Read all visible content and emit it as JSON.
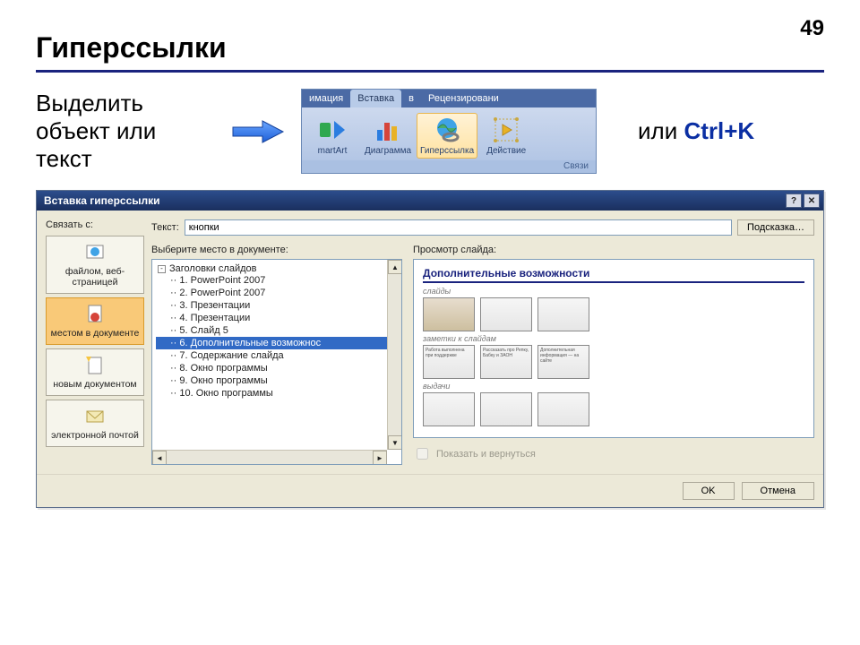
{
  "page_number": "49",
  "title": "Гиперссылки",
  "instruction": "Выделить объект или текст",
  "or_text": "или ",
  "shortcut": "Ctrl+K",
  "ribbon": {
    "tabs": [
      "имация",
      "Вставка",
      "в",
      "Рецензировани"
    ],
    "active_index": 1,
    "buttons": {
      "smartart": "martArt",
      "chart": "Диаграмма",
      "hyperlink": "Гиперссылка",
      "action": "Действие"
    },
    "group_label": "Связи"
  },
  "dialog": {
    "title": "Вставка гиперссылки",
    "link_with_label": "Связать с:",
    "text_label": "Текст:",
    "text_value": "кнопки",
    "hint_button": "Подсказка…",
    "link_targets": {
      "webpage": "файлом, веб-страницей",
      "place": "местом в документе",
      "newdoc": "новым документом",
      "email": "электронной почтой"
    },
    "tree_label": "Выберите место в документе:",
    "tree_root": "Заголовки слайдов",
    "tree_items": [
      "1. PowerPoint 2007",
      "2. PowerPoint 2007",
      "3. Презентации",
      "4. Презентации",
      "5. Слайд 5",
      "6. Дополнительные возможнос",
      "7. Содержание слайда",
      "8. Окно программы",
      "9. Окно программы",
      "10. Окно программы"
    ],
    "tree_selected_index": 5,
    "preview_label": "Просмотр слайда:",
    "preview_title": "Дополнительные возможности",
    "preview_sections": {
      "slides": "слайды",
      "notes": "заметки к слайдам",
      "handouts": "выдачи"
    },
    "show_return": "Показать и вернуться",
    "ok": "OK",
    "cancel": "Отмена"
  }
}
